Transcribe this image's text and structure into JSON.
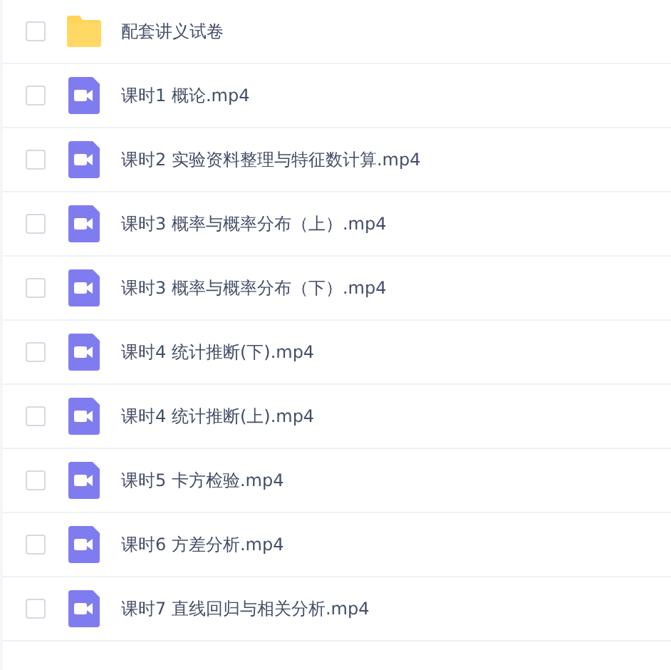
{
  "files": [
    {
      "kind": "folder",
      "name": "配套讲义试卷",
      "checked": false
    },
    {
      "kind": "video",
      "name": "课时1 概论.mp4",
      "checked": false
    },
    {
      "kind": "video",
      "name": "课时2 实验资料整理与特征数计算.mp4",
      "checked": false
    },
    {
      "kind": "video",
      "name": "课时3 概率与概率分布（上）.mp4",
      "checked": false
    },
    {
      "kind": "video",
      "name": "课时3 概率与概率分布（下）.mp4",
      "checked": false
    },
    {
      "kind": "video",
      "name": "课时4 统计推断(下).mp4",
      "checked": false
    },
    {
      "kind": "video",
      "name": "课时4 统计推断(上).mp4",
      "checked": false
    },
    {
      "kind": "video",
      "name": "课时5 卡方检验.mp4",
      "checked": false
    },
    {
      "kind": "video",
      "name": "课时6 方差分析.mp4",
      "checked": false
    },
    {
      "kind": "video",
      "name": "课时7 直线回归与相关分析.mp4",
      "checked": false
    }
  ]
}
